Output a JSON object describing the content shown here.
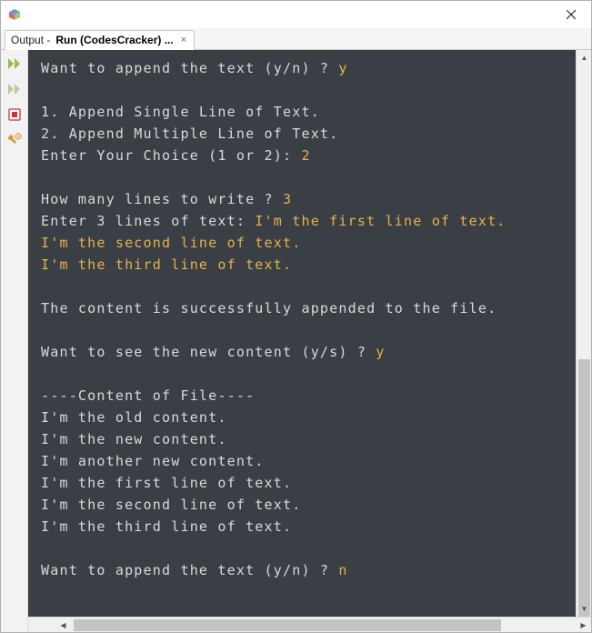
{
  "titlebar": {
    "title": ""
  },
  "tab": {
    "prefix": "Output - ",
    "bold": "Run (CodesCracker) ...",
    "close_glyph": "×"
  },
  "gutter": {
    "rerun": "rerun-icon",
    "step": "step-icon",
    "stop": "stop-icon",
    "settings": "settings-icon"
  },
  "console": {
    "lines": [
      {
        "segs": [
          {
            "t": "Want to append the text (y/n) ? "
          },
          {
            "t": "y",
            "in": true
          }
        ]
      },
      {
        "segs": [
          {
            "t": ""
          }
        ]
      },
      {
        "segs": [
          {
            "t": "1. Append Single Line of Text."
          }
        ]
      },
      {
        "segs": [
          {
            "t": "2. Append Multiple Line of Text."
          }
        ]
      },
      {
        "segs": [
          {
            "t": "Enter Your Choice (1 or 2): "
          },
          {
            "t": "2",
            "in": true
          }
        ]
      },
      {
        "segs": [
          {
            "t": ""
          }
        ]
      },
      {
        "segs": [
          {
            "t": "How many lines to write ? "
          },
          {
            "t": "3",
            "in": true
          }
        ]
      },
      {
        "segs": [
          {
            "t": "Enter 3 lines of text: "
          },
          {
            "t": "I'm the first line of text.",
            "in": true
          }
        ]
      },
      {
        "segs": [
          {
            "t": "I'm the second line of text.",
            "in": true
          }
        ]
      },
      {
        "segs": [
          {
            "t": "I'm the third line of text.",
            "in": true
          }
        ]
      },
      {
        "segs": [
          {
            "t": ""
          }
        ]
      },
      {
        "segs": [
          {
            "t": "The content is successfully appended to the file."
          }
        ]
      },
      {
        "segs": [
          {
            "t": ""
          }
        ]
      },
      {
        "segs": [
          {
            "t": "Want to see the new content (y/s) ? "
          },
          {
            "t": "y",
            "in": true
          }
        ]
      },
      {
        "segs": [
          {
            "t": ""
          }
        ]
      },
      {
        "segs": [
          {
            "t": "----Content of File----"
          }
        ]
      },
      {
        "segs": [
          {
            "t": "I'm the old content."
          }
        ]
      },
      {
        "segs": [
          {
            "t": "I'm the new content."
          }
        ]
      },
      {
        "segs": [
          {
            "t": "I'm another new content."
          }
        ]
      },
      {
        "segs": [
          {
            "t": "I'm the first line of text."
          }
        ]
      },
      {
        "segs": [
          {
            "t": "I'm the second line of text."
          }
        ]
      },
      {
        "segs": [
          {
            "t": "I'm the third line of text."
          }
        ]
      },
      {
        "segs": [
          {
            "t": ""
          }
        ]
      },
      {
        "segs": [
          {
            "t": "Want to append the text (y/n) ? "
          },
          {
            "t": "n",
            "in": true
          }
        ]
      }
    ]
  }
}
